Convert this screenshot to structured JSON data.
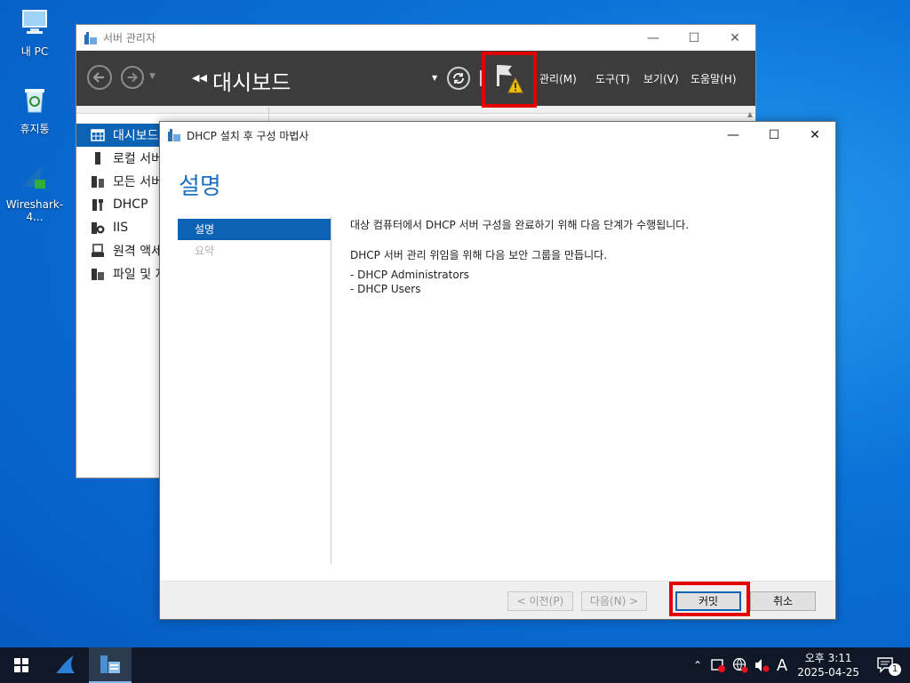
{
  "desktop": {
    "icons": [
      {
        "label": "내 PC",
        "icon": "computer-icon"
      },
      {
        "label": "휴지통",
        "icon": "recycle-bin-icon"
      },
      {
        "label": "Wireshark-4...",
        "icon": "wireshark-icon"
      }
    ]
  },
  "server_manager": {
    "title": "서버 관리자",
    "page_title": "대시보드",
    "menus": [
      "관리(M)",
      "도구(T)",
      "보기(V)",
      "도움말(H)"
    ],
    "nav": [
      "대시보드",
      "로컬 서버",
      "모든 서버",
      "DHCP",
      "IIS",
      "원격 액세스",
      "파일 및 저장소 서비스"
    ]
  },
  "wizard": {
    "title": "DHCP 설치 후 구성 마법사",
    "heading": "설명",
    "steps": [
      "설명",
      "요약"
    ],
    "intro": "대상 컴퓨터에서 DHCP 서버 구성을 완료하기 위해 다음 단계가 수행됩니다.",
    "group_intro": "DHCP 서버 관리 위임을 위해 다음 보안 그룹을 만듭니다.",
    "groups": [
      "- DHCP Administrators",
      "- DHCP Users"
    ],
    "buttons": {
      "prev": "< 이전(P)",
      "next": "다음(N) >",
      "commit": "커밋",
      "cancel": "취소"
    }
  },
  "taskbar": {
    "time": "오후 3:11",
    "date": "2025-04-25",
    "ime": "A",
    "notification_count": "1"
  },
  "colors": {
    "accent": "#0c63b4",
    "highlight": "#e50000",
    "warning": "#f3c010"
  }
}
